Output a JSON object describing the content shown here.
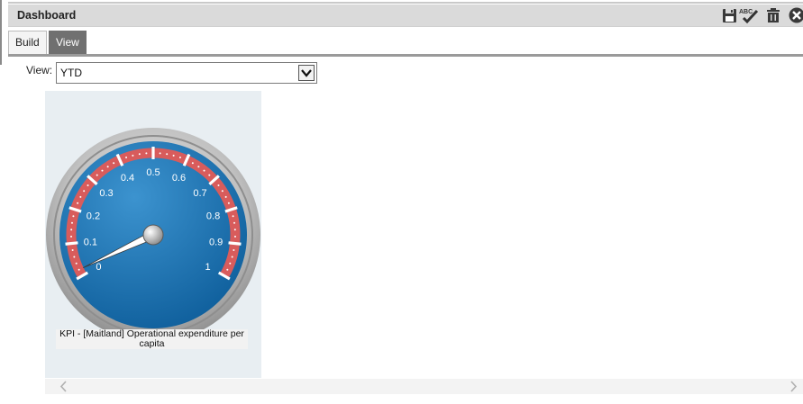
{
  "header": {
    "title": "Dashboard"
  },
  "toolbar": {
    "icons": [
      "save-icon",
      "spellcheck-icon",
      "delete-icon",
      "close-icon"
    ],
    "spellcheck_text": "ABC"
  },
  "tabs": [
    {
      "label": "Build",
      "active": false
    },
    {
      "label": "View",
      "active": true
    }
  ],
  "view_selector": {
    "label": "View:",
    "value": "YTD"
  },
  "gauge": {
    "caption": "KPI - [Maitland] Operational expenditure per capita",
    "min": 0,
    "max": 1,
    "tick_labels": [
      "0",
      "0.1",
      "0.2",
      "0.3",
      "0.4",
      "0.5",
      "0.6",
      "0.7",
      "0.8",
      "0.9",
      "1"
    ],
    "needle_value": 0.02,
    "colors": {
      "face": "#1a72b3",
      "band": "#d85c5c",
      "rim": "#b4b4b4",
      "panel": "#e8eef2"
    }
  },
  "scrollbar": {
    "left_icon": "chevron-left-icon",
    "right_icon": "chevron-right-icon"
  }
}
